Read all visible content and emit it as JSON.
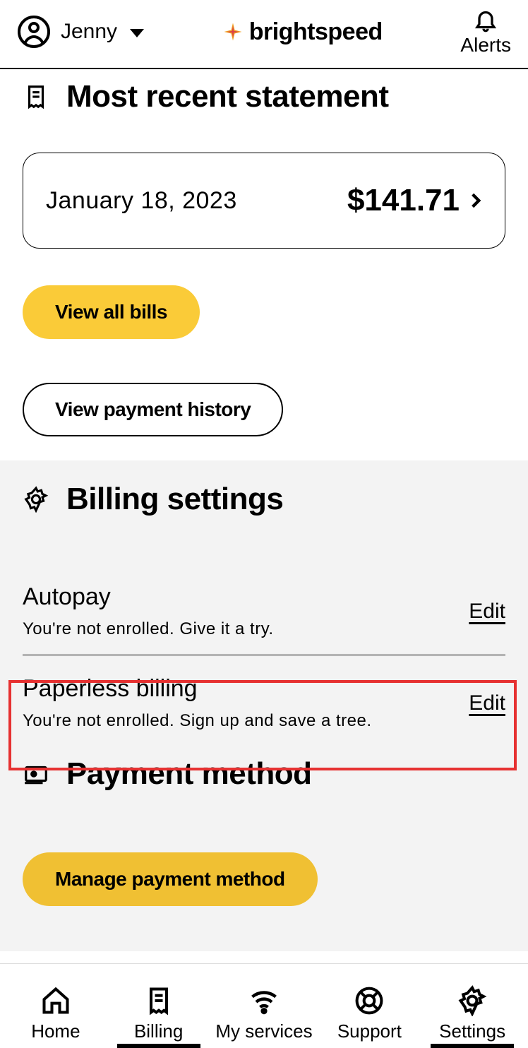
{
  "header": {
    "user_name": "Jenny",
    "brand": "brightspeed",
    "alerts_label": "Alerts"
  },
  "statement": {
    "section_title": "Most recent statement",
    "date": "January 18, 2023",
    "amount": "$141.71",
    "view_all_label": "View all bills",
    "view_history_label": "View payment history"
  },
  "billing_settings": {
    "section_title": "Billing settings",
    "items": [
      {
        "title": "Autopay",
        "desc": "You're not enrolled. Give it a try.",
        "action": "Edit"
      },
      {
        "title": "Paperless billing",
        "desc": "You're not enrolled. Sign up and save a tree.",
        "action": "Edit"
      }
    ]
  },
  "payment_method": {
    "section_title": "Payment method",
    "manage_label": "Manage payment method"
  },
  "nav": {
    "home": "Home",
    "billing": "Billing",
    "services": "My services",
    "support": "Support",
    "settings": "Settings"
  }
}
